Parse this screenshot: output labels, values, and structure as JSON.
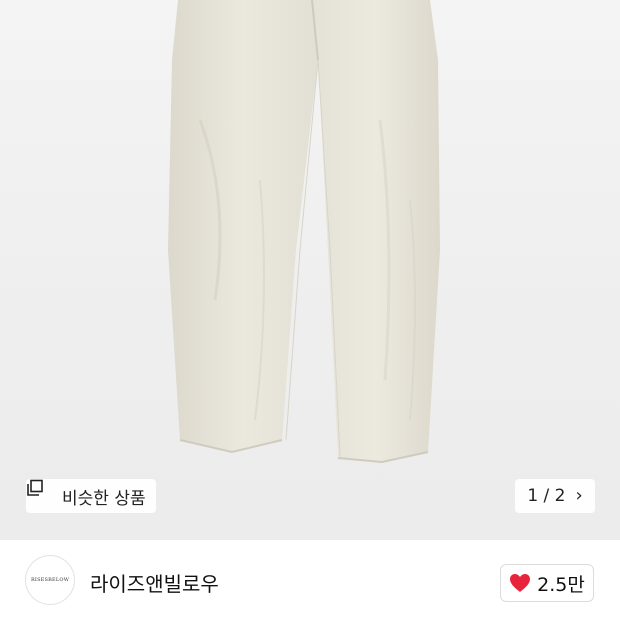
{
  "product_image": {
    "alt": "",
    "similar_products_label": "비슷한 상품",
    "counter_text": "1 / 2",
    "chevron": "›"
  },
  "shop": {
    "avatar_logo_text": "RISESBELOW",
    "name": "라이즈앤빌로우",
    "like_count": "2.5만"
  },
  "colors": {
    "heart": "#e8243c",
    "pants": "#e9e6dc"
  },
  "icons": {
    "similar": "copy-squares-icon",
    "counter": "chevron-right-icon",
    "like": "heart-icon"
  }
}
